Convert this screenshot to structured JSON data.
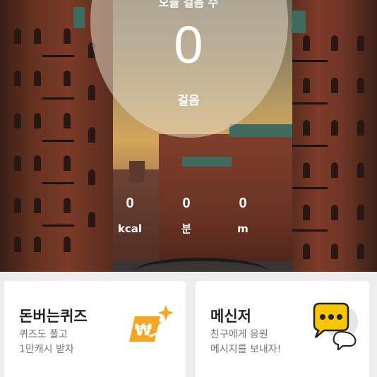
{
  "header": {
    "label": "오늘 걸음 수"
  },
  "steps": {
    "value": "0",
    "label": "걸음"
  },
  "stats": [
    {
      "value": "0",
      "unit": "kcal"
    },
    {
      "value": "0",
      "unit": "분"
    },
    {
      "value": "0",
      "unit": "m"
    }
  ],
  "cards": [
    {
      "title": "돈버는퀴즈",
      "desc": "퀴즈도 풀고\n1만캐시 받자",
      "icon": "quiz-won-icon"
    },
    {
      "title": "메신저",
      "desc": "친구에게 응원\n메시지를 보내자!",
      "icon": "chat-bubbles-icon"
    }
  ],
  "colors": {
    "quiz_accent": "#f5a623",
    "messenger_accent": "#f7c600"
  }
}
